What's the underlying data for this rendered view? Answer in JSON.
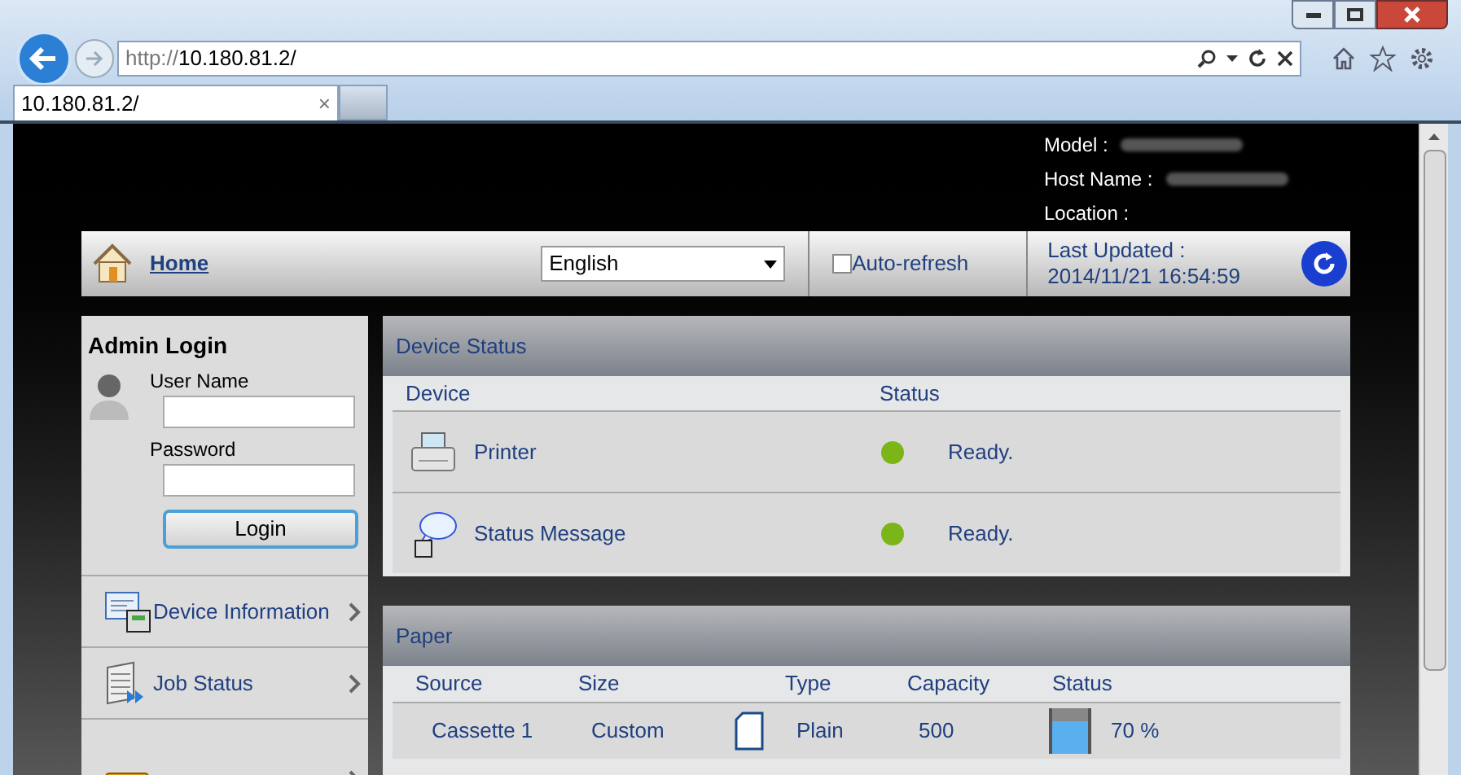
{
  "browser": {
    "url_scheme": "http://",
    "url_host": "10.180.81.2/",
    "tab": {
      "title": "10.180.81.2/",
      "close": "×"
    }
  },
  "header": {
    "info": [
      {
        "label": "Model :",
        "blurred": true
      },
      {
        "label": "Host Name :",
        "blurred": true
      },
      {
        "label": "Location :",
        "blurred": false
      }
    ]
  },
  "toolbar": {
    "home": "Home",
    "language": "English",
    "auto_refresh": {
      "label": "Auto-refresh",
      "checked": false
    },
    "last_updated_label": "Last Updated :",
    "last_updated": "2014/11/21 16:54:59"
  },
  "login": {
    "title": "Admin Login",
    "user_label": "User Name",
    "password_label": "Password",
    "button": "Login"
  },
  "sidebar": {
    "items": [
      {
        "label": "Device Information",
        "kind": "device"
      },
      {
        "label": "Job Status",
        "kind": "jobs"
      },
      {
        "kind": "box"
      }
    ]
  },
  "device_status": {
    "title": "Device Status",
    "columns": [
      "Device",
      "Status"
    ],
    "rows": [
      {
        "kind": "printer",
        "name": "Printer",
        "status": "Ready.",
        "color": "#7cb518"
      },
      {
        "kind": "message",
        "name": "Status Message",
        "status": "Ready.",
        "color": "#7cb518"
      }
    ]
  },
  "paper": {
    "title": "Paper",
    "columns": [
      "Source",
      "Size",
      "Type",
      "Capacity",
      "Status"
    ],
    "rows": [
      {
        "source": "Cassette 1",
        "size": "Custom",
        "type": "Plain",
        "capacity": "500",
        "level": 0.7,
        "reading": "70 %"
      }
    ]
  }
}
